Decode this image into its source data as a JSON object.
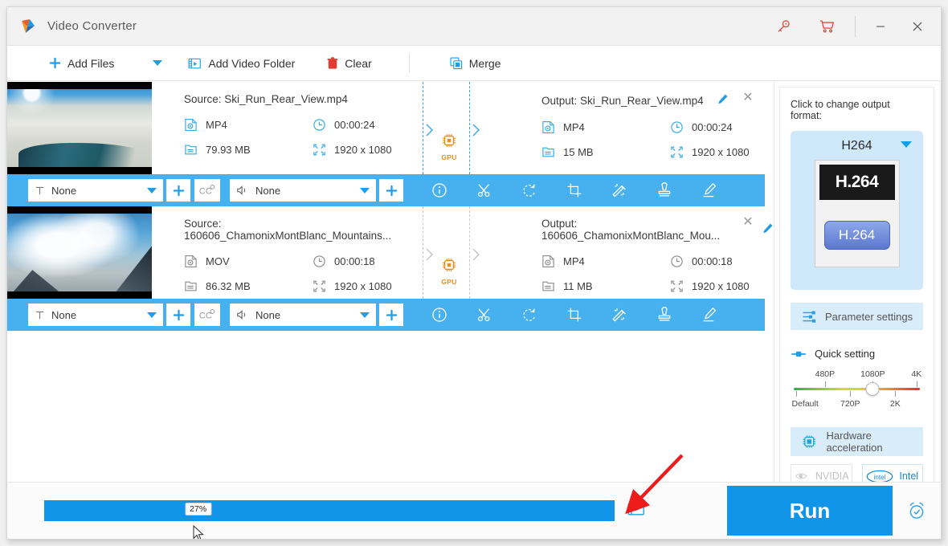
{
  "window": {
    "title": "Video Converter",
    "logo": "app-logo-icon",
    "license_icon": "key-icon",
    "cart_icon": "cart-icon",
    "minimize": "–",
    "close": "✕"
  },
  "toolbar": {
    "add_files": "Add Files",
    "add_files_caret": "chevron-down-icon",
    "add_video_folder": "Add Video Folder",
    "clear": "Clear",
    "merge": "Merge"
  },
  "files": [
    {
      "thumbnail": "ski-slope-thumbnail",
      "source_label": "Source: Ski_Run_Rear_View.mp4",
      "source_format": "MP4",
      "source_duration": "00:00:24",
      "source_size": "79.93 MB",
      "source_resolution": "1920 x 1080",
      "gpu_badge": "GPU",
      "output_label": "Output: Ski_Run_Rear_View.mp4",
      "output_format": "MP4",
      "output_duration": "00:00:24",
      "output_size": "15 MB",
      "output_resolution": "1920 x 1080",
      "subtitle_value": "None",
      "audio_value": "None",
      "selected": true
    },
    {
      "thumbnail": "mountain-clouds-thumbnail",
      "source_label": "Source: 160606_ChamonixMontBlanc_Mountains...",
      "source_format": "MOV",
      "source_duration": "00:00:18",
      "source_size": "86.32 MB",
      "source_resolution": "1920 x 1080",
      "gpu_badge": "GPU",
      "output_label": "Output: 160606_ChamonixMontBlanc_Mou...",
      "output_format": "MP4",
      "output_duration": "00:00:18",
      "output_size": "11 MB",
      "output_resolution": "1920 x 1080",
      "subtitle_value": "None",
      "audio_value": "None",
      "selected": false
    }
  ],
  "row_tools": {
    "info": "info-icon",
    "cut": "scissors-icon",
    "rotate": "rotate-icon",
    "crop": "crop-icon",
    "effect": "magic-wand-icon",
    "watermark": "stamp-icon",
    "edit": "signature-icon",
    "cc": "cc",
    "plus": "+"
  },
  "right_panel": {
    "hint": "Click to change output format:",
    "format_name": "H264",
    "format_logo_top": "H.264",
    "format_logo_pill": "H.264",
    "parameter_settings": "Parameter settings",
    "quick_setting": "Quick setting",
    "quality_ticks_top": [
      "480P",
      "1080P",
      "4K"
    ],
    "quality_ticks_bottom": [
      "Default",
      "720P",
      "2K"
    ],
    "quality_selected": "1080P",
    "hardware_acceleration": "Hardware acceleration",
    "vendor_nvidia": "NVIDIA",
    "vendor_intel": "Intel",
    "accent_color": "#1095e8",
    "panel_blue": "#cfe8fa"
  },
  "bottom": {
    "progress_percent": "27%",
    "progress_value": 27,
    "open_folder_icon": "film-folder-icon",
    "run_label": "Run",
    "schedule_icon": "alarm-clock-icon"
  },
  "annotation": {
    "arrow": "red-annotation-arrow",
    "arrow_color": "#ee1b1b"
  }
}
